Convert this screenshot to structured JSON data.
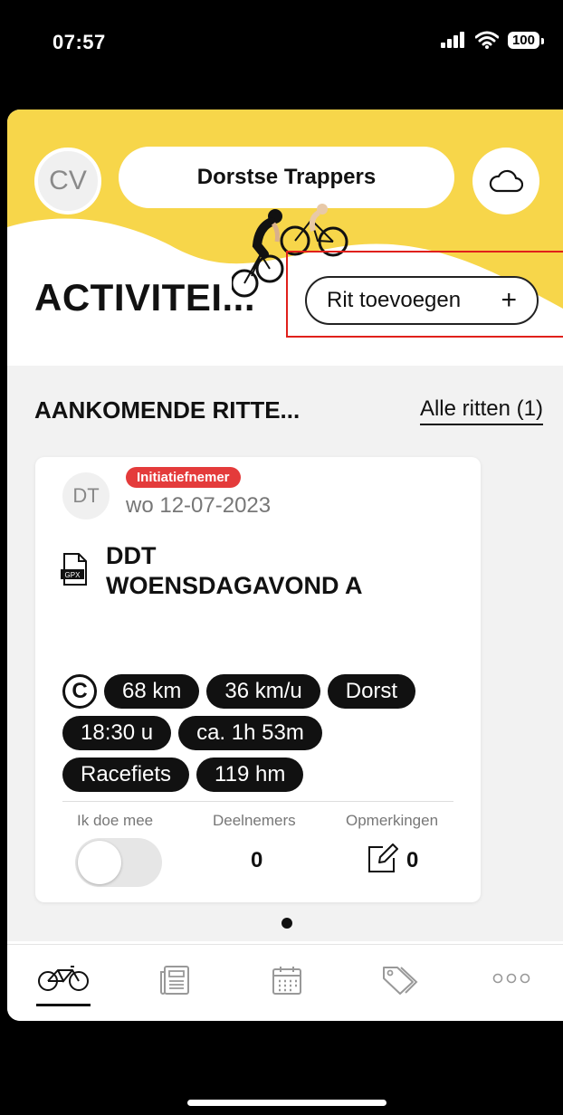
{
  "status_bar": {
    "time": "07:57",
    "battery": "100"
  },
  "header": {
    "avatar_initials": "CV",
    "club_name": "Dorstse Trappers"
  },
  "activities": {
    "title": "ACTIVITEI...",
    "add_ride_label": "Rit toevoegen",
    "add_icon": "+"
  },
  "upcoming": {
    "title": "AANKOMENDE RITTE...",
    "all_rides_link": "Alle ritten (1)",
    "card": {
      "avatar_initials": "DT",
      "badge": "Initiatiefnemer",
      "date": "wo 12-07-2023",
      "name_line1": "DDT",
      "name_line2": "WOENSDAGAVOND A",
      "gpx_label": "GPX",
      "category_icon": "C",
      "chips": [
        "68 km",
        "36 km/u",
        "Dorst",
        "18:30 u",
        "ca. 1h 53m",
        "Racefiets",
        "119 hm"
      ],
      "join_label": "Ik doe mee",
      "join_on": false,
      "participants_label": "Deelnemers",
      "participants_value": "0",
      "comments_label": "Opmerkingen",
      "comments_value": "0"
    }
  },
  "tabs": [
    "bike-icon",
    "news-icon",
    "calendar-icon",
    "tag-icon",
    "more-icon"
  ],
  "colors": {
    "brand_yellow": "#F7D64A",
    "badge_red": "#E43B3B",
    "highlight_red": "#E0201B"
  }
}
